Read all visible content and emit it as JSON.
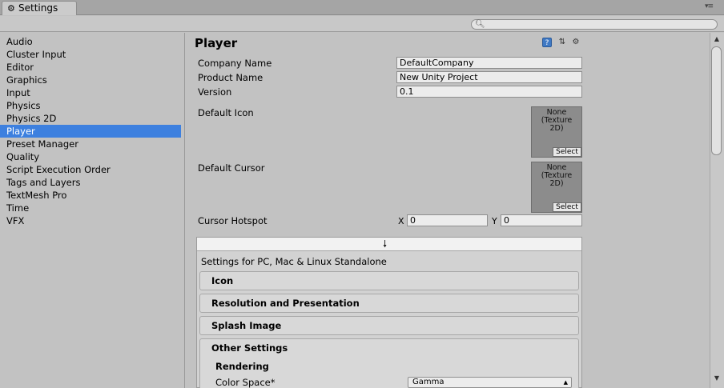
{
  "window": {
    "tab_label": "Settings",
    "menu_glyph": "▾≡"
  },
  "search": {
    "placeholder": ""
  },
  "sidebar": {
    "items": [
      {
        "label": "Audio"
      },
      {
        "label": "Cluster Input"
      },
      {
        "label": "Editor"
      },
      {
        "label": "Graphics"
      },
      {
        "label": "Input"
      },
      {
        "label": "Physics"
      },
      {
        "label": "Physics 2D"
      },
      {
        "label": "Player",
        "selected": true
      },
      {
        "label": "Preset Manager"
      },
      {
        "label": "Quality"
      },
      {
        "label": "Script Execution Order"
      },
      {
        "label": "Tags and Layers"
      },
      {
        "label": "TextMesh Pro"
      },
      {
        "label": "Time"
      },
      {
        "label": "VFX"
      }
    ]
  },
  "main": {
    "title": "Player",
    "header_icons": [
      "help-icon",
      "preset-icon",
      "gear-icon"
    ],
    "fields": {
      "company_name": {
        "label": "Company Name",
        "value": "DefaultCompany"
      },
      "product_name": {
        "label": "Product Name",
        "value": "New Unity Project"
      },
      "version": {
        "label": "Version",
        "value": "0.1"
      },
      "default_icon": {
        "label": "Default Icon",
        "texture": "None\n(Texture\n2D)",
        "select": "Select"
      },
      "default_cursor": {
        "label": "Default Cursor",
        "texture": "None\n(Texture\n2D)",
        "select": "Select"
      },
      "cursor_hotspot": {
        "label": "Cursor Hotspot",
        "x_label": "X",
        "x_value": "0",
        "y_label": "Y",
        "y_value": "0"
      }
    },
    "platform": {
      "title": "Settings for PC, Mac & Linux Standalone",
      "sections": [
        "Icon",
        "Resolution and Presentation",
        "Splash Image"
      ],
      "other_settings": {
        "label": "Other Settings",
        "rendering_label": "Rendering",
        "color_space_label": "Color Space*",
        "color_space_value": "Gamma"
      }
    }
  },
  "colors": {
    "selection": "#3d80df",
    "background": "#c2c2c2"
  }
}
